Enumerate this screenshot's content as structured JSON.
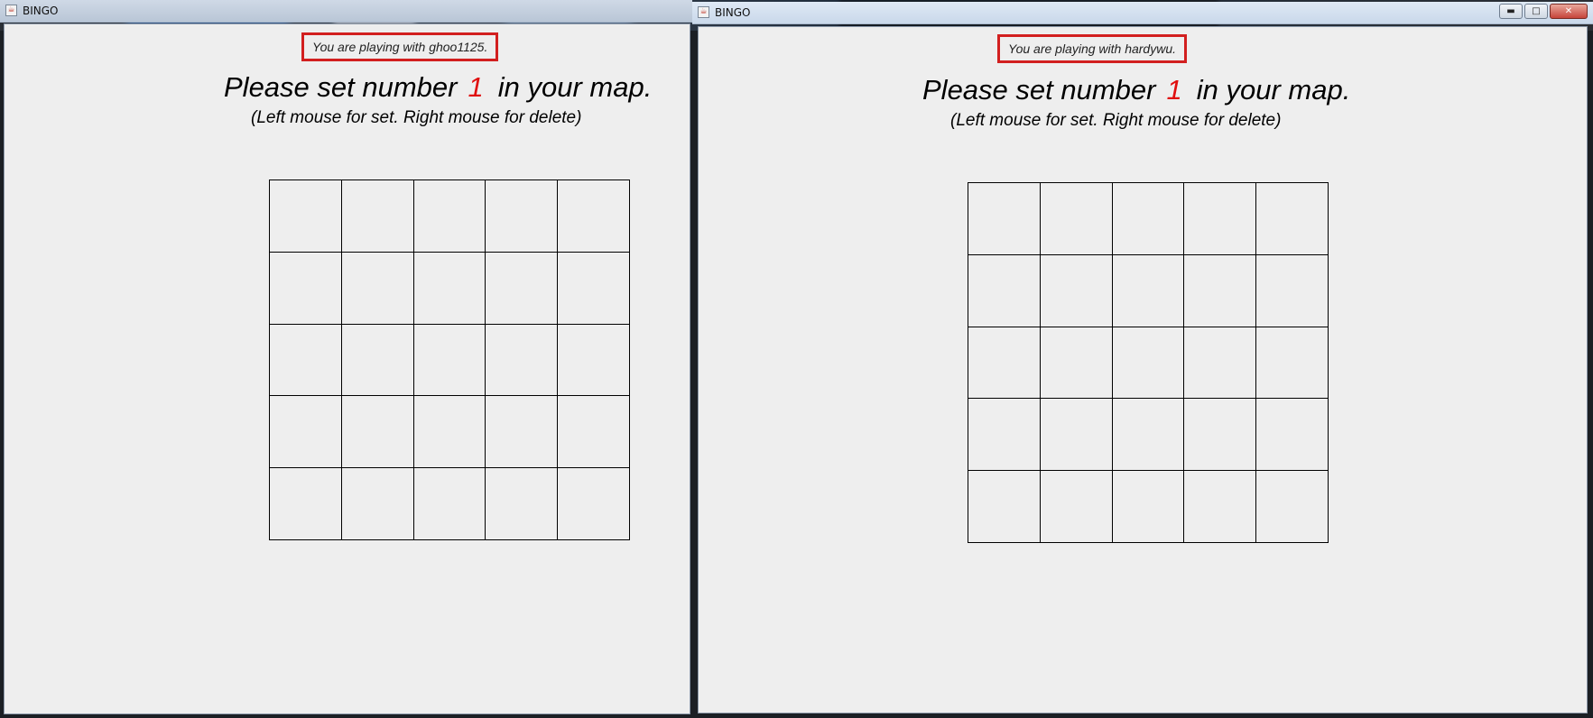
{
  "windows": [
    {
      "id": "left",
      "title": "BINGO",
      "opponent_text": "You are playing with ghoo1125.",
      "prompt_before": "Please set number",
      "prompt_number": "1",
      "prompt_after": "in your map.",
      "hint": "(Left mouse for set. Right mouse for delete)"
    },
    {
      "id": "right",
      "title": "BINGO",
      "opponent_text": "You are playing with hardywu.",
      "prompt_before": "Please set number",
      "prompt_number": "1",
      "prompt_after": "in your map.",
      "hint": "(Left mouse for set. Right mouse for delete)",
      "controls": {
        "minimize": "▬",
        "maximize": "□",
        "close": "✕"
      }
    }
  ],
  "colors": {
    "highlight_border": "#d21f1f",
    "number": "#e01010",
    "panel_bg": "#eeeeee"
  }
}
